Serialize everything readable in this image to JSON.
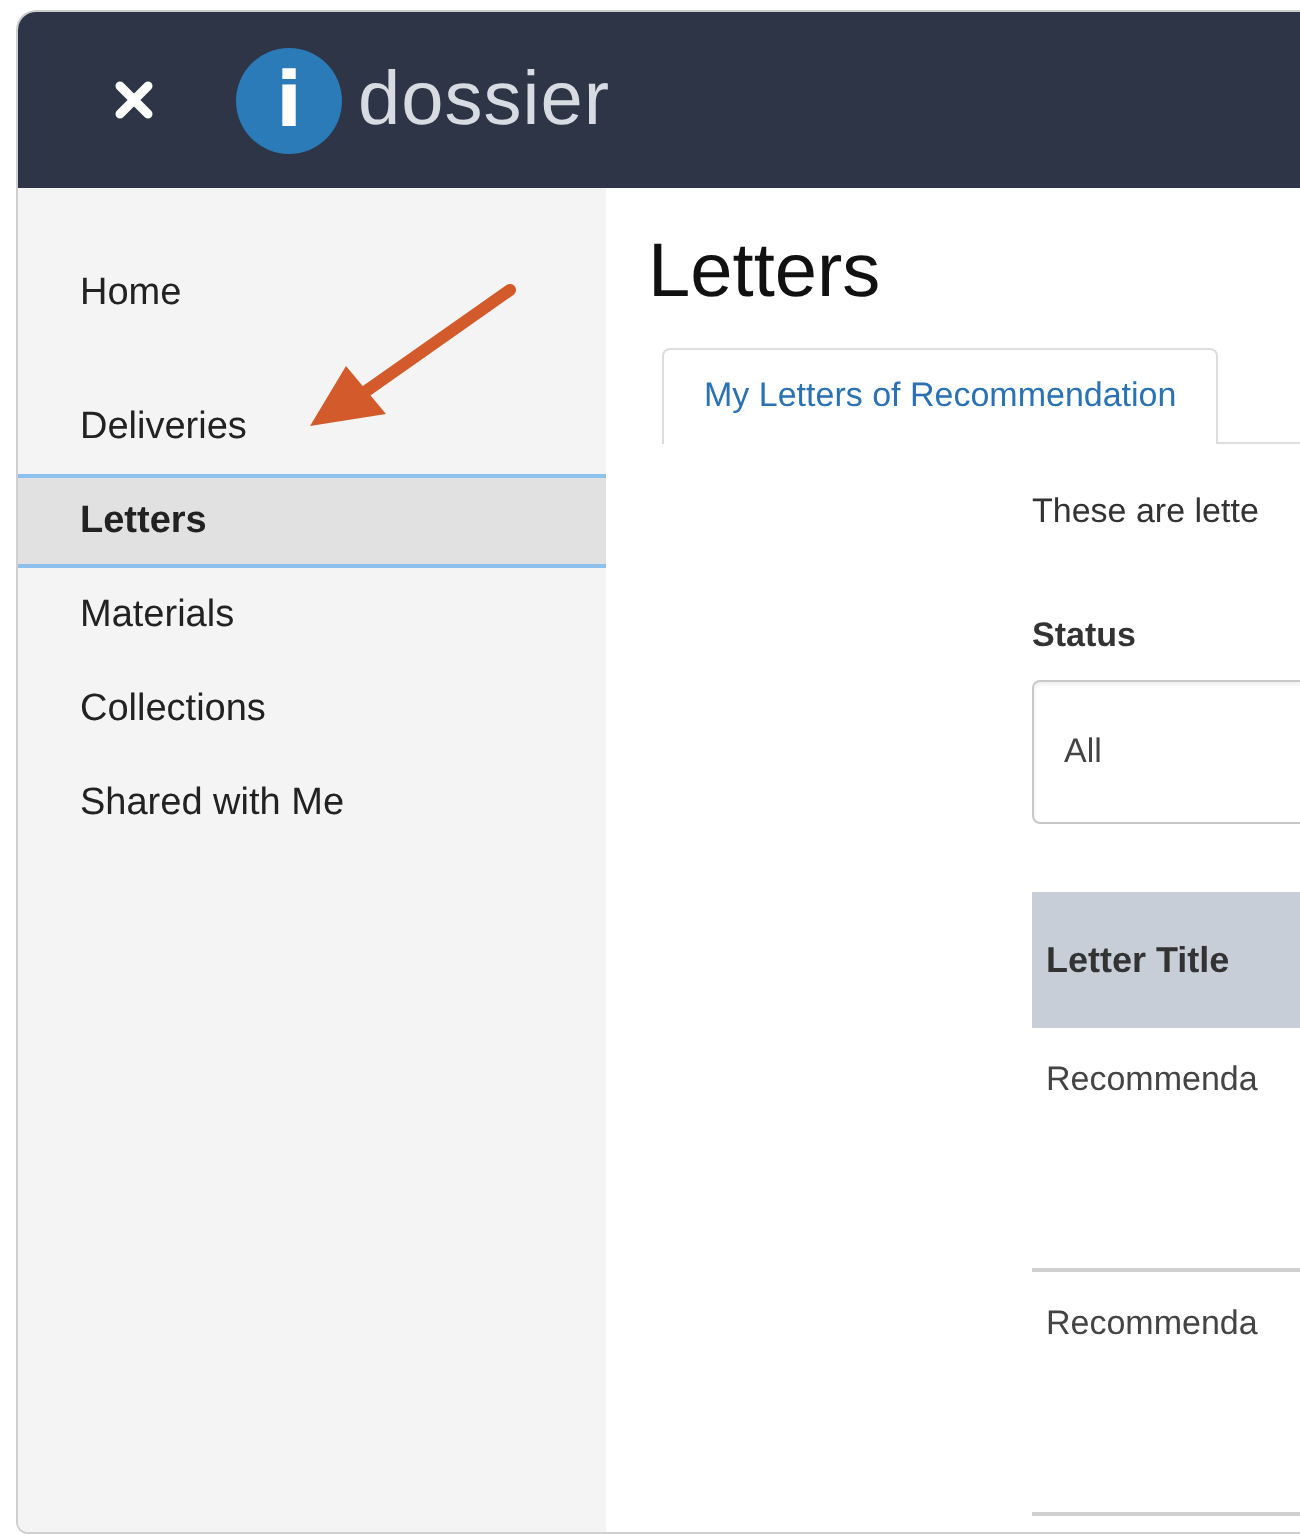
{
  "header": {
    "logo_mark": "i",
    "app_name": "dossier"
  },
  "sidebar": {
    "items": [
      {
        "label": "Home",
        "selected": false
      },
      {
        "label": "Deliveries",
        "selected": false
      },
      {
        "label": "Letters",
        "selected": true
      },
      {
        "label": "Materials",
        "selected": false
      },
      {
        "label": "Collections",
        "selected": false
      },
      {
        "label": "Shared with Me",
        "selected": false
      }
    ]
  },
  "page_title": "Letters",
  "tabs": [
    {
      "label": "My Letters of Recommendation",
      "selected": true
    }
  ],
  "description": "These are lette",
  "status_filter": {
    "label": "Status",
    "value": "All"
  },
  "table": {
    "columns": [
      "Letter Title"
    ],
    "rows": [
      [
        "Recommenda"
      ],
      [
        "Recommenda"
      ]
    ]
  }
}
